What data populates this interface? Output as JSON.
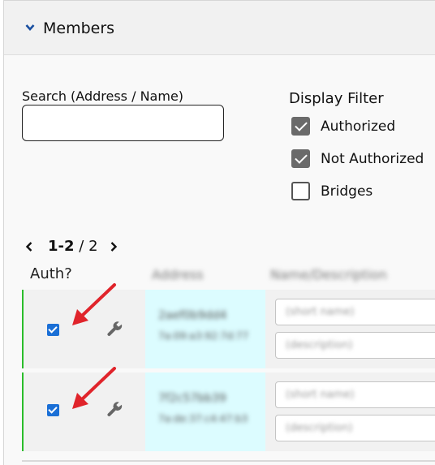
{
  "panel": {
    "title": "Members"
  },
  "search": {
    "label": "Search (Address / Name)",
    "value": "",
    "placeholder": ""
  },
  "display_filter": {
    "title": "Display Filter",
    "options": [
      {
        "label": "Authorized",
        "checked": true
      },
      {
        "label": "Not Authorized",
        "checked": true
      },
      {
        "label": "Bridges",
        "checked": false
      }
    ]
  },
  "pagination": {
    "range": "1-2",
    "separator": "/",
    "total": "2"
  },
  "table": {
    "columns": {
      "auth": "Auth?",
      "address": "Address",
      "name": "Name/Description"
    },
    "rows": [
      {
        "authorized": true,
        "address": "2aef0b9dd4",
        "mac": "7a:09:a3:92:7d:77",
        "short_name_placeholder": "(short name)",
        "description_placeholder": "(description)"
      },
      {
        "authorized": true,
        "address": "7f2c57bb39",
        "mac": "7a:de:37:c4:47:b3",
        "short_name_placeholder": "(short name)",
        "description_placeholder": "(description)"
      }
    ]
  },
  "colors": {
    "accent_green": "#2bbd2b",
    "checkbox_blue": "#1a6fd6",
    "arrow_red": "#e0242b",
    "address_bg": "#dcfcff"
  }
}
